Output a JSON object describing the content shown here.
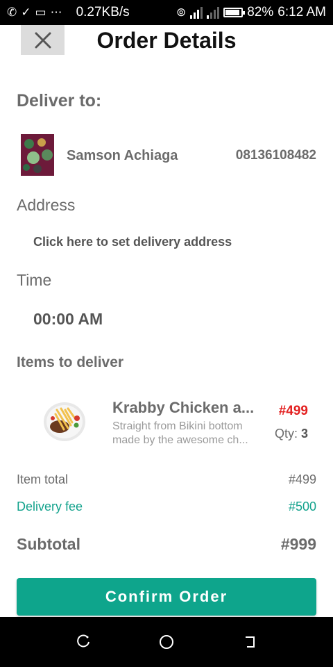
{
  "status_bar": {
    "speed": "0.27KB/s",
    "battery": "82%",
    "time": "6:12 AM",
    "battery_level": 0.82
  },
  "header": {
    "title": "Order Details",
    "close_icon": "close-icon"
  },
  "deliver_to": {
    "label": "Deliver to:",
    "customer_name": "Samson Achiaga",
    "phone": "08136108482"
  },
  "address": {
    "label": "Address",
    "action": "Click here to set delivery address"
  },
  "time": {
    "label": "Time",
    "value": "00:00 AM"
  },
  "items": {
    "label": "Items to deliver",
    "list": [
      {
        "name": "Krabby Chicken a...",
        "description_line1": "Straight from Bikini bottom",
        "description_line2": "made by the awesome ch...",
        "price": "#499",
        "qty_label": "Qty:",
        "qty": "3"
      }
    ]
  },
  "summary": {
    "item_total_label": "Item total",
    "item_total": "#499",
    "delivery_fee_label": "Delivery fee",
    "delivery_fee": "#500",
    "subtotal_label": "Subtotal",
    "subtotal": "#999"
  },
  "confirm_button": "Confirm Order",
  "colors": {
    "accent": "#0ea58c",
    "price": "#e32020",
    "text": "#6b6b6b"
  }
}
